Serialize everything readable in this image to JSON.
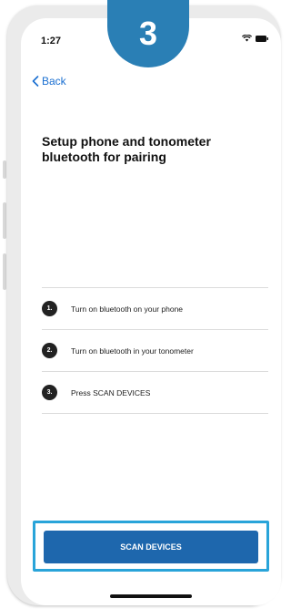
{
  "badge": {
    "number": "3"
  },
  "status_bar": {
    "time": "1:27"
  },
  "nav": {
    "back_label": "Back"
  },
  "page": {
    "title": "Setup phone and tonometer bluetooth for pairing"
  },
  "steps": [
    {
      "number": "1.",
      "text": "Turn on bluetooth on your phone"
    },
    {
      "number": "2.",
      "text": "Turn on bluetooth in your tonometer"
    },
    {
      "number": "3.",
      "text": "Press SCAN DEVICES"
    }
  ],
  "actions": {
    "scan_label": "SCAN DEVICES"
  },
  "colors": {
    "badge": "#2a7fb5",
    "primary_button": "#1e67ad",
    "highlight": "#29a4d9",
    "link": "#1a6fd1"
  }
}
